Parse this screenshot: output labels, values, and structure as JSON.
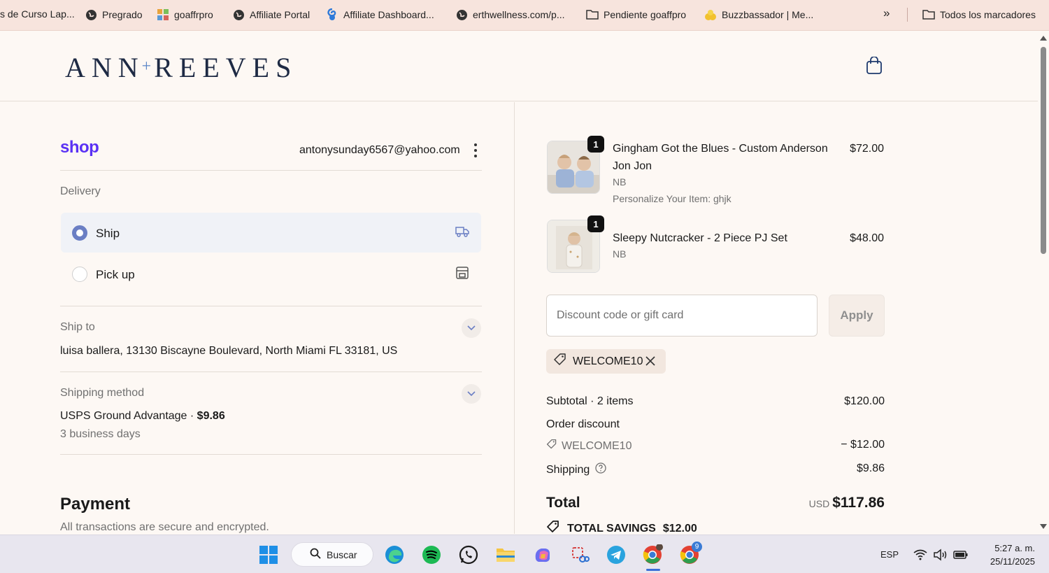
{
  "bookmarks": {
    "items": [
      {
        "label": "s de Curso Lap..."
      },
      {
        "label": "Pregrado"
      },
      {
        "label": "goaffrpro"
      },
      {
        "label": "Affiliate Portal"
      },
      {
        "label": "Affiliate Dashboard..."
      },
      {
        "label": "erthwellness.com/p..."
      },
      {
        "label": "Pendiente goaffpro"
      },
      {
        "label": "Buzzbassador | Me..."
      }
    ],
    "overflow": "»",
    "all_label": "Todos los marcadores"
  },
  "header": {
    "brand_left": "ANN",
    "brand_plus": "+",
    "brand_right": "REEVES"
  },
  "account": {
    "shop_logo": "shop",
    "email": "antonysunday6567@yahoo.com"
  },
  "delivery": {
    "label": "Delivery",
    "options": [
      {
        "label": "Ship",
        "selected": true
      },
      {
        "label": "Pick up",
        "selected": false
      }
    ]
  },
  "ship_to": {
    "label": "Ship to",
    "address": "luisa ballera, 13130 Biscayne Boulevard, North Miami FL 33181, US"
  },
  "shipping_method": {
    "label": "Shipping method",
    "name": "USPS Ground Advantage",
    "separator": " · ",
    "price": "$9.86",
    "eta": "3 business days"
  },
  "payment": {
    "title": "Payment",
    "subtitle": "All transactions are secure and encrypted."
  },
  "cart": {
    "items": [
      {
        "qty": "1",
        "name": "Gingham Got the Blues - Custom Anderson Jon Jon",
        "variant": "NB",
        "personalization": "Personalize Your Item: ghjk",
        "price": "$72.00"
      },
      {
        "qty": "1",
        "name": "Sleepy Nutcracker - 2 Piece PJ Set",
        "variant": "NB",
        "price": "$48.00"
      }
    ],
    "discount_placeholder": "Discount code or gift card",
    "apply_label": "Apply",
    "applied_code": "WELCOME10"
  },
  "summary": {
    "subtotal_label": "Subtotal · 2 items",
    "subtotal_value": "$120.00",
    "order_discount_label": "Order discount",
    "discount_code": "WELCOME10",
    "discount_value": "− $12.00",
    "shipping_label": "Shipping",
    "shipping_value": "$9.86",
    "total_label": "Total",
    "currency": "USD",
    "total_value": "$117.86",
    "savings_label": "TOTAL SAVINGS",
    "savings_value": "$12.00"
  },
  "taskbar": {
    "search_label": "Buscar",
    "lang": "ESP",
    "time": "5:27 a. m.",
    "date": "25/11/2025",
    "chrome_badge": "9"
  },
  "colors": {
    "shop_purple": "#5a31f4",
    "brand_navy": "#1e2a44",
    "radio_accent": "#6b7fc4",
    "bookmark_bar": "#f7e4dd"
  }
}
